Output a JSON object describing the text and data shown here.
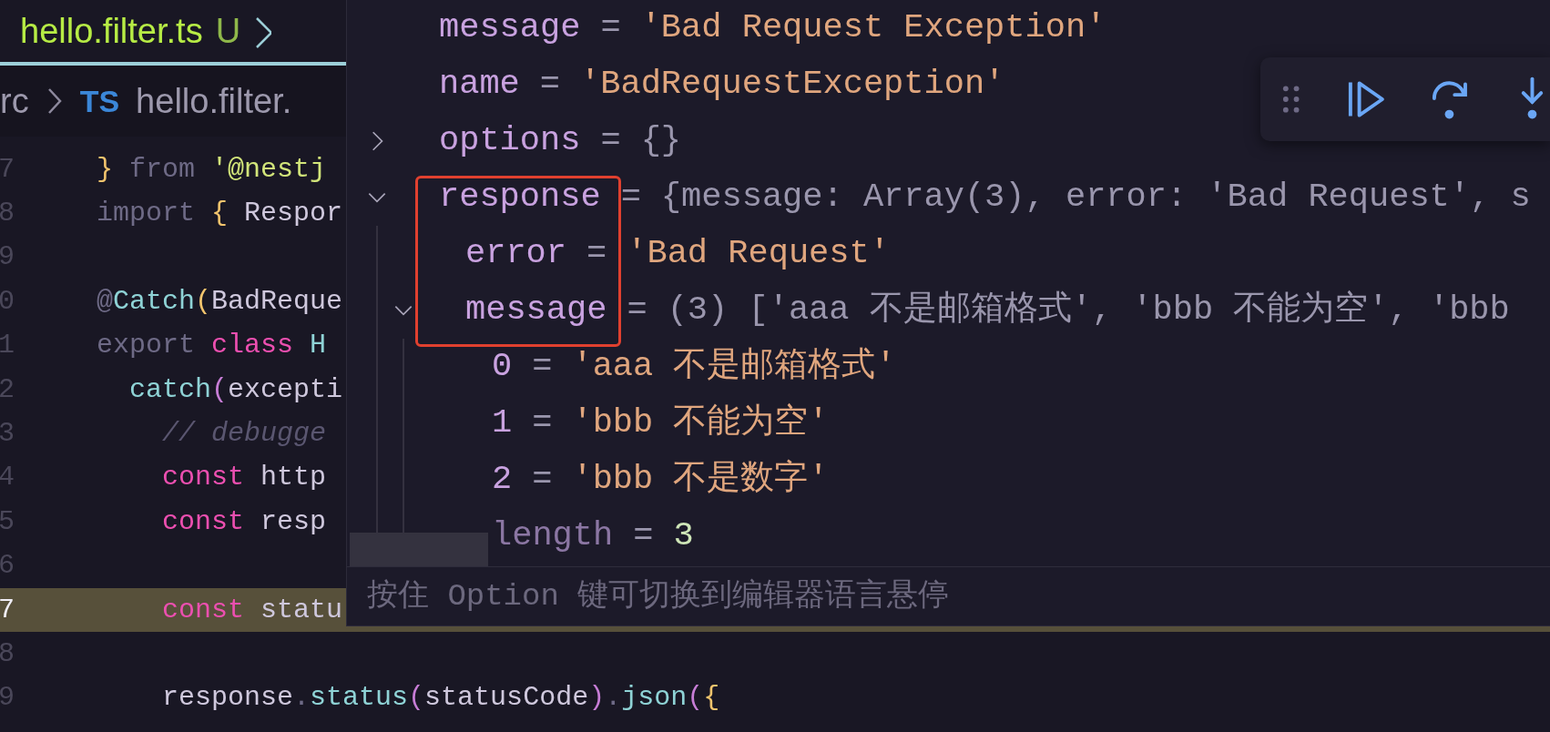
{
  "tab": {
    "filename": "hello.filter.ts",
    "status": "U"
  },
  "breadcrumb": {
    "folder": "rc",
    "file_badge": "TS",
    "file": "hello.filter."
  },
  "editor": {
    "lines": [
      {
        "number": "7",
        "current": false,
        "tokens": [
          {
            "text": "}",
            "kind": "brace"
          },
          {
            "text": " from ",
            "kind": "dim"
          },
          {
            "text": "'@nestj",
            "kind": "string"
          }
        ]
      },
      {
        "number": "8",
        "current": false,
        "tokens": [
          {
            "text": "import ",
            "kind": "dim"
          },
          {
            "text": "{",
            "kind": "brace"
          },
          {
            "text": " Respor",
            "kind": "plain"
          }
        ]
      },
      {
        "number": "9",
        "current": false
      },
      {
        "number": "0",
        "current": false,
        "tokens": [
          {
            "text": "@",
            "kind": "dim"
          },
          {
            "text": "Catch",
            "kind": "function"
          },
          {
            "text": "(",
            "kind": "brace"
          },
          {
            "text": "BadReque",
            "kind": "plain"
          }
        ]
      },
      {
        "number": "1",
        "current": false,
        "tokens": [
          {
            "text": "export ",
            "kind": "dim"
          },
          {
            "text": "class ",
            "kind": "keyword"
          },
          {
            "text": "H",
            "kind": "function"
          }
        ]
      },
      {
        "number": "2",
        "current": false,
        "tokens": [
          {
            "text": "  catch",
            "kind": "function"
          },
          {
            "text": "(",
            "kind": "paren"
          },
          {
            "text": "excepti",
            "kind": "plain"
          }
        ]
      },
      {
        "number": "3",
        "current": false,
        "tokens": [
          {
            "text": "    // debugge",
            "kind": "comment"
          }
        ]
      },
      {
        "number": "4",
        "current": false,
        "tokens": [
          {
            "text": "    const ",
            "kind": "keyword"
          },
          {
            "text": "http",
            "kind": "plain"
          }
        ]
      },
      {
        "number": "5",
        "current": false,
        "tokens": [
          {
            "text": "    const ",
            "kind": "keyword"
          },
          {
            "text": "resp",
            "kind": "plain"
          }
        ]
      },
      {
        "number": "6",
        "current": false
      },
      {
        "number": "7",
        "current": true,
        "tokens": [
          {
            "text": "    const ",
            "kind": "keyword"
          },
          {
            "text": "statu",
            "kind": "plain"
          }
        ]
      },
      {
        "number": "8",
        "current": false
      },
      {
        "number": "9",
        "current": false,
        "tokens": [
          {
            "text": "    response",
            "kind": "plain"
          },
          {
            "text": ".",
            "kind": "dim"
          },
          {
            "text": "status",
            "kind": "function"
          },
          {
            "text": "(",
            "kind": "paren"
          },
          {
            "text": "statusCode",
            "kind": "plain"
          },
          {
            "text": ")",
            "kind": "paren"
          },
          {
            "text": ".",
            "kind": "dim"
          },
          {
            "text": "json",
            "kind": "function"
          },
          {
            "text": "(",
            "kind": "paren"
          },
          {
            "text": "{",
            "kind": "brace"
          }
        ]
      }
    ]
  },
  "hover": {
    "items": [
      {
        "key": "message",
        "kind": "property",
        "separator": "=",
        "value": {
          "text": "'Bad Request Exception'",
          "kind": "string"
        }
      },
      {
        "key": "name",
        "kind": "property",
        "separator": "=",
        "value": {
          "text": "'BadRequestException'",
          "kind": "string"
        }
      },
      {
        "key": "options",
        "kind": "property",
        "separator": "=",
        "value": {
          "text": "{}",
          "kind": "object"
        },
        "expanded": false
      },
      {
        "key": "response",
        "kind": "property",
        "separator": "=",
        "value": {
          "text": "{message: Array(3), error: 'Bad Request', s",
          "kind": "preview"
        },
        "expanded": true,
        "children": [
          {
            "key": "error",
            "kind": "property",
            "separator": "=",
            "value": {
              "text": "'Bad Request'",
              "kind": "string"
            }
          },
          {
            "key": "message",
            "kind": "property",
            "separator": "=",
            "value": {
              "text": "(3) ['aaa 不是邮箱格式', 'bbb 不能为空', 'bbb",
              "kind": "preview"
            },
            "expanded": true,
            "children": [
              {
                "key": "0",
                "kind": "property",
                "separator": "=",
                "value": {
                  "text": "'aaa 不是邮箱格式'",
                  "kind": "string"
                }
              },
              {
                "key": "1",
                "kind": "property",
                "separator": "=",
                "value": {
                  "text": "'bbb 不能为空'",
                  "kind": "string"
                }
              },
              {
                "key": "2",
                "kind": "property",
                "separator": "=",
                "value": {
                  "text": "'bbb 不是数字'",
                  "kind": "string"
                }
              },
              {
                "key": "length",
                "kind": "internal",
                "separator": "=",
                "value": {
                  "text": "3",
                  "kind": "number"
                }
              }
            ]
          }
        ]
      }
    ],
    "hint": "按住 Option 键可切换到编辑器语言悬停"
  }
}
